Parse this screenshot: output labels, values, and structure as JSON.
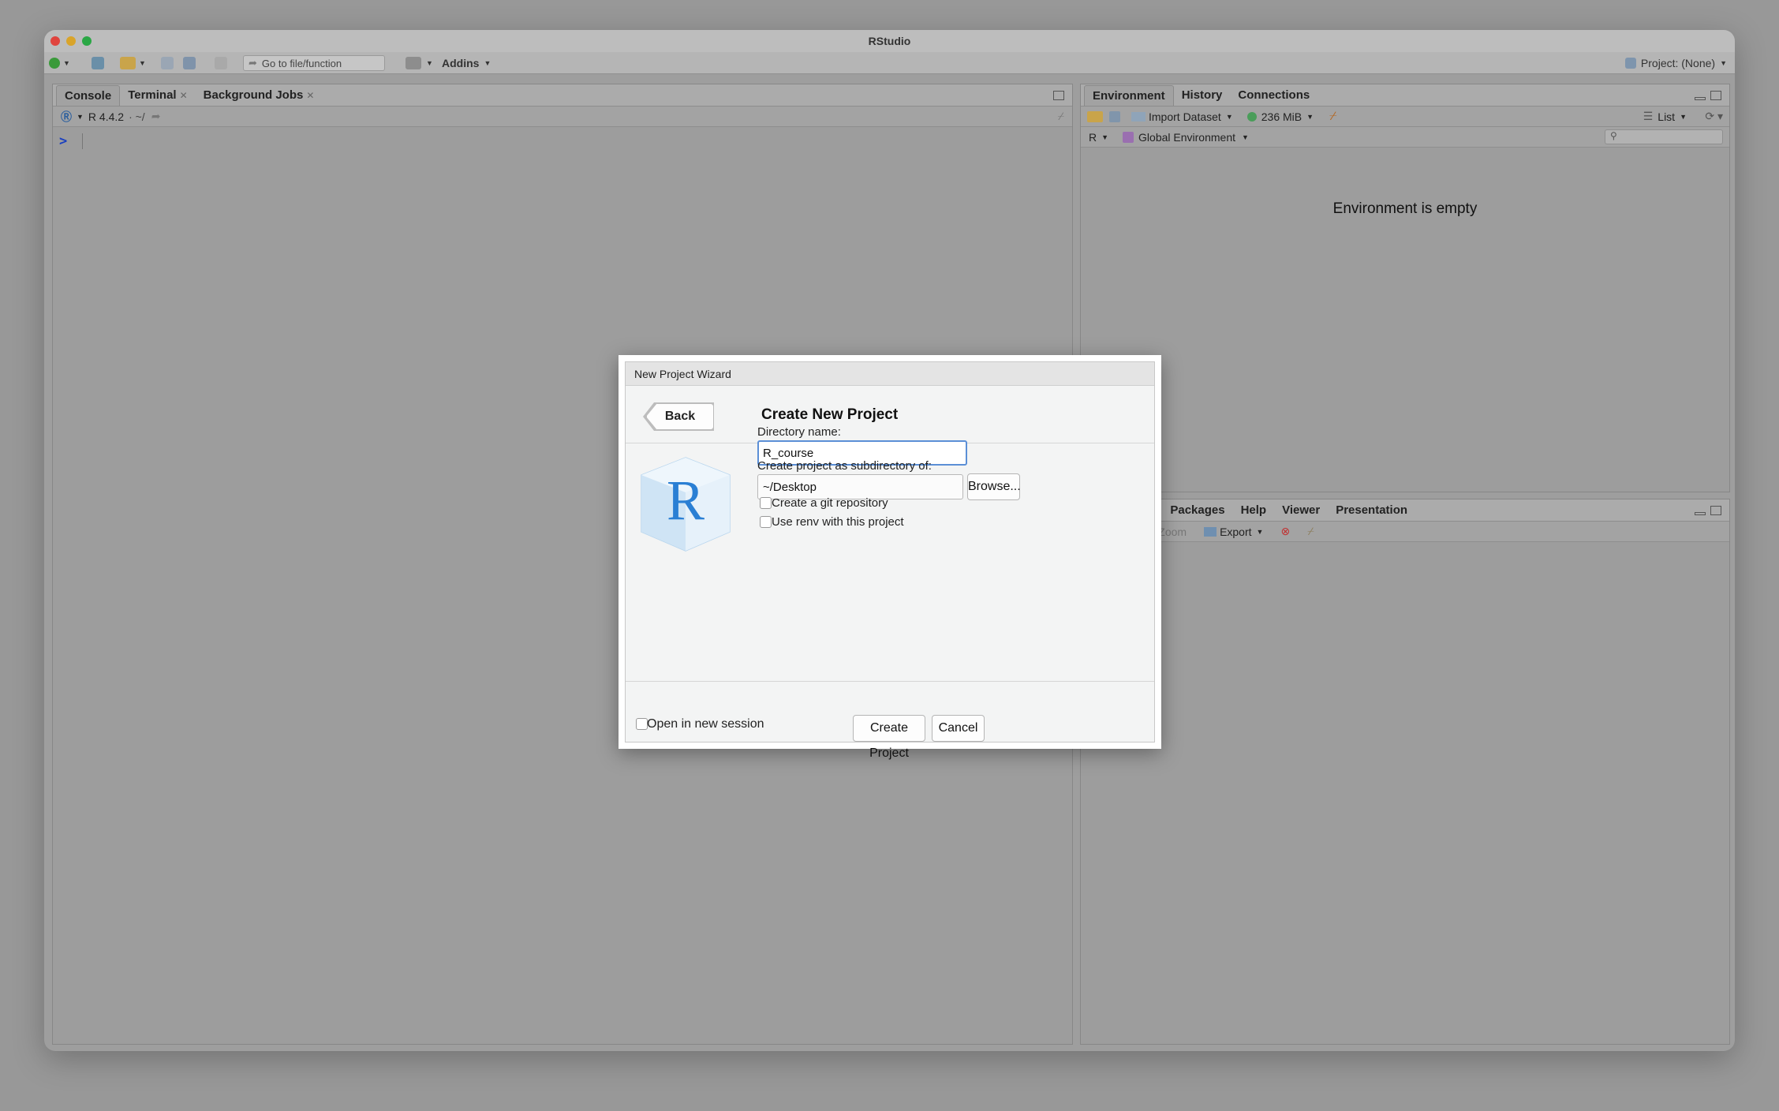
{
  "window": {
    "title": "RStudio",
    "project_label": "Project: (None)"
  },
  "toolbar": {
    "goto_placeholder": "Go to file/function",
    "addins_label": "Addins"
  },
  "console_pane": {
    "tabs": [
      {
        "label": "Console",
        "closable": false
      },
      {
        "label": "Terminal",
        "closable": true
      },
      {
        "label": "Background Jobs",
        "closable": true
      }
    ],
    "r_version": "R 4.4.2",
    "path": "· ~/",
    "prompt": ">"
  },
  "env_pane": {
    "tabs": [
      "Environment",
      "History",
      "Connections"
    ],
    "import_label": "Import Dataset",
    "memory_label": "236 MiB",
    "list_label": "List",
    "lang_label": "R",
    "scope_label": "Global Environment",
    "empty_message": "Environment is empty"
  },
  "files_pane": {
    "tabs": [
      "ts",
      "Packages",
      "Help",
      "Viewer",
      "Presentation"
    ],
    "zoom_label": "Zoom",
    "export_label": "Export"
  },
  "dialog": {
    "title": "New Project Wizard",
    "back_label": "Back",
    "heading": "Create New Project",
    "directory_label": "Directory name:",
    "directory_value": "R_course",
    "subdir_label": "Create project as subdirectory of:",
    "subdir_value": "~/Desktop",
    "browse_label": "Browse...",
    "git_label": "Create a git repository",
    "git_checked": false,
    "renv_label": "Use renv with this project",
    "renv_checked": false,
    "new_session_label": "Open in new session",
    "new_session_checked": false,
    "create_label": "Create Project",
    "cancel_label": "Cancel",
    "logo_letter": "R"
  },
  "colors": {
    "accent_focus": "#5b8fd6",
    "r_logo_blue": "#2a7fd4",
    "prompt_blue": "#1a3fbf"
  }
}
